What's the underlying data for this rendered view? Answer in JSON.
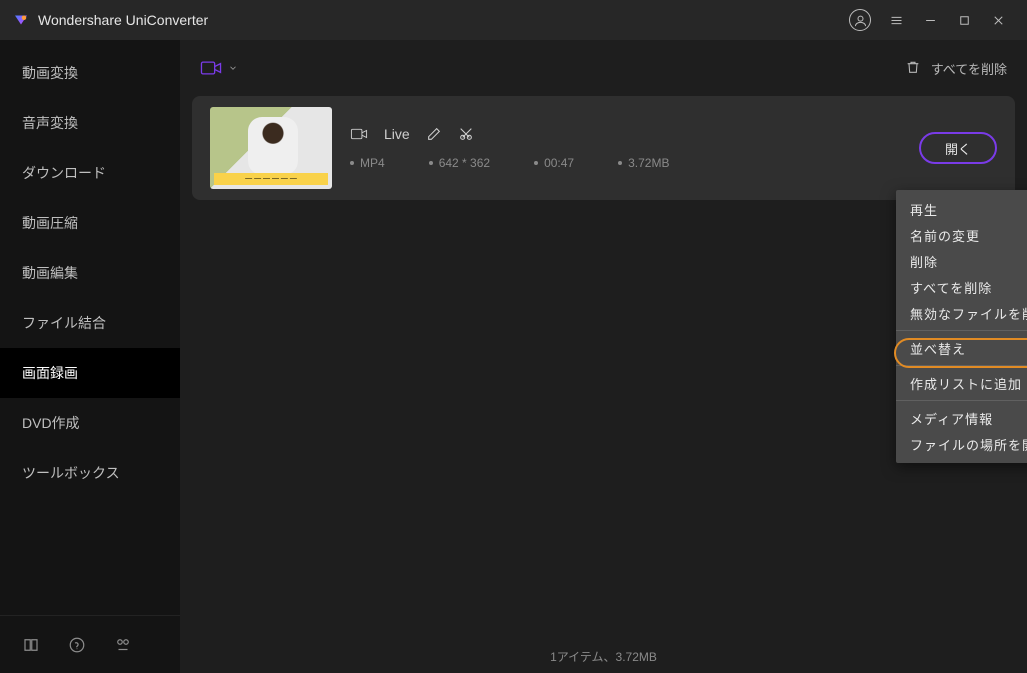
{
  "app": {
    "title": "Wondershare UniConverter"
  },
  "sidebar": {
    "items": [
      {
        "label": "動画変換"
      },
      {
        "label": "音声変換"
      },
      {
        "label": "ダウンロード"
      },
      {
        "label": "動画圧縮"
      },
      {
        "label": "動画編集"
      },
      {
        "label": "ファイル結合"
      },
      {
        "label": "画面録画"
      },
      {
        "label": "DVD作成"
      },
      {
        "label": "ツールボックス"
      }
    ],
    "active_index": 6
  },
  "toolbar": {
    "delete_all": "すべてを削除"
  },
  "file": {
    "name": "Live",
    "format": "MP4",
    "resolution": "642 * 362",
    "duration": "00:47",
    "size": "3.72MB",
    "open_label": "開く"
  },
  "context_menu": {
    "items": [
      {
        "label": "再生"
      },
      {
        "label": "名前の変更"
      },
      {
        "label": "削除"
      },
      {
        "label": "すべてを削除"
      },
      {
        "label": "無効なファイルを削除"
      },
      {
        "label": "並べ替え",
        "submenu": true
      },
      {
        "label": "作成リストに追加"
      },
      {
        "label": "メディア情報"
      },
      {
        "label": "ファイルの場所を開く"
      }
    ],
    "highlighted_index": 6
  },
  "statusbar": {
    "text": "1アイテム、3.72MB"
  }
}
